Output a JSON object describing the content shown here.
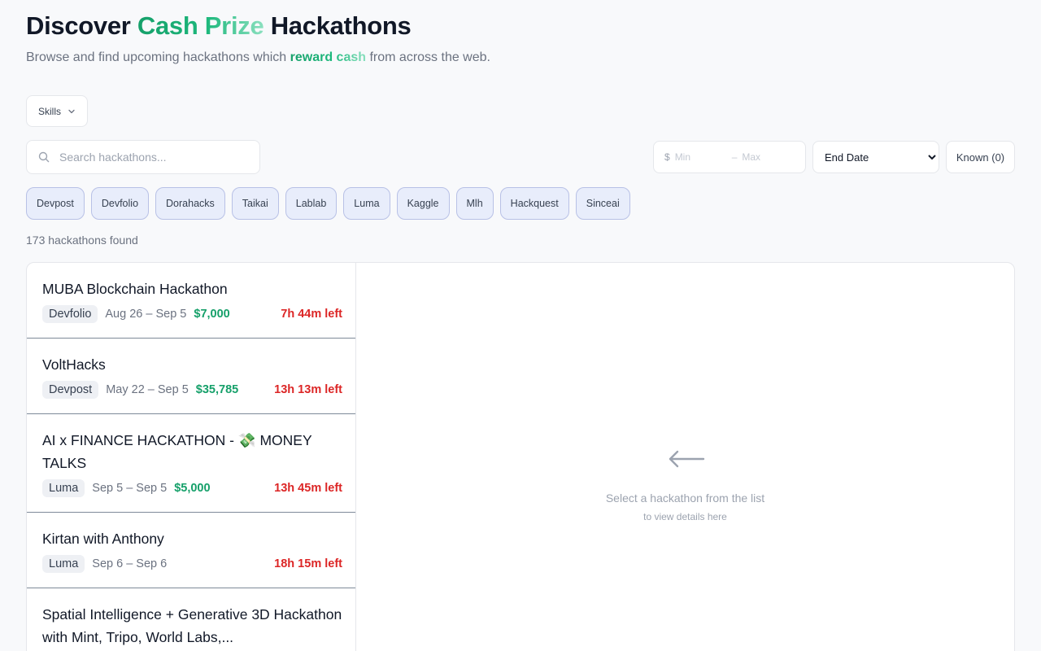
{
  "header": {
    "title_pre": "Discover ",
    "title_accent": "Cash Prize",
    "title_post": " Hackathons",
    "subtitle_pre": "Browse and find upcoming hackathons which ",
    "subtitle_accent": "reward cash",
    "subtitle_post": " from across the web."
  },
  "filters": {
    "skills_label": "Skills",
    "search_placeholder": "Search hackathons...",
    "currency_symbol": "$",
    "min_placeholder": "Min",
    "range_dash": "–",
    "max_placeholder": "Max",
    "sort_selected": "End Date",
    "known_label": "Known (0)"
  },
  "sources": [
    "Devpost",
    "Devfolio",
    "Dorahacks",
    "Taikai",
    "Lablab",
    "Luma",
    "Kaggle",
    "Mlh",
    "Hackquest",
    "Sinceai"
  ],
  "results_count": "173 hackathons found",
  "hackathons": [
    {
      "title": "MUBA Blockchain Hackathon",
      "source": "Devfolio",
      "dates": "Aug 26 – Sep 5",
      "prize": "$7,000",
      "time_left": "7h 44m left"
    },
    {
      "title": "VoltHacks",
      "source": "Devpost",
      "dates": "May 22 – Sep 5",
      "prize": "$35,785",
      "time_left": "13h 13m left"
    },
    {
      "title": "AI x FINANCE HACKATHON - 💸 MONEY TALKS",
      "source": "Luma",
      "dates": "Sep 5 – Sep 5",
      "prize": "$5,000",
      "time_left": "13h 45m left"
    },
    {
      "title": "Kirtan with Anthony",
      "source": "Luma",
      "dates": "Sep 6 – Sep 6",
      "prize": "",
      "time_left": "18h 15m left"
    },
    {
      "title": "Spatial Intelligence + Generative 3D Hackathon with Mint, Tripo, World Labs,...",
      "source": "",
      "dates": "",
      "prize": "",
      "time_left": ""
    }
  ],
  "detail_empty": {
    "message": "Select a hackathon from the list",
    "hint": "to view details here"
  },
  "colors": {
    "accent_green": "#16a06a",
    "time_left_red": "#dc2626",
    "chip_bg": "#e8edfb"
  }
}
